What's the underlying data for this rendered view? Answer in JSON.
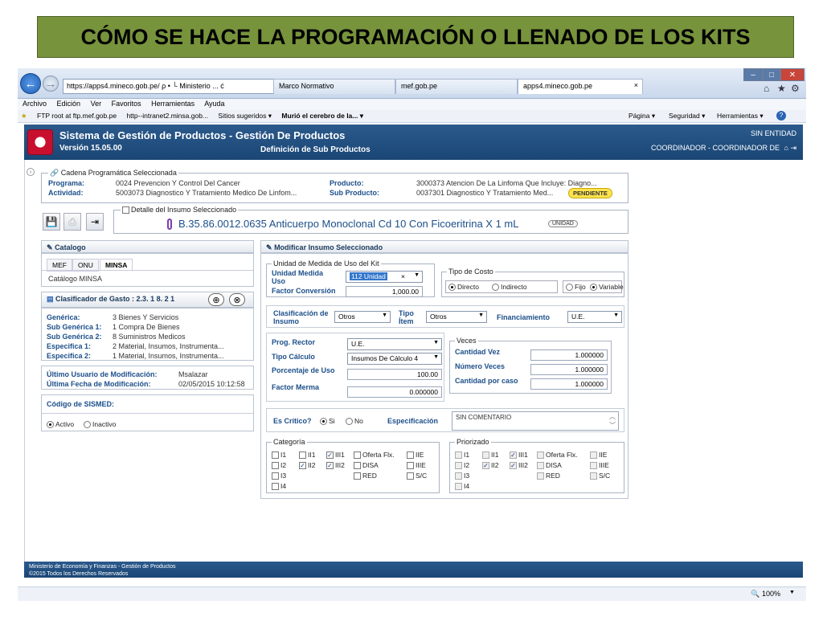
{
  "slide": {
    "title": "CÓMO SE HACE LA PROGRAMACIÓN O LLENADO DE LOS KITS"
  },
  "browser": {
    "address": "https://apps4.mineco.gob.pe/ ρ • └ Ministerio ... ć",
    "address_short": "https://apps4.mineco.gob.pe/",
    "ministerio": "Ministerio ...",
    "tabs": [
      "Marco Normativo",
      "mef.gob.pe",
      "apps4.mineco.gob.pe"
    ],
    "tab_close": "×",
    "menu": [
      "Archivo",
      "Edición",
      "Ver",
      "Favoritos",
      "Herramientas",
      "Ayuda"
    ],
    "favorites": [
      "FTP root at ftp.mef.gob.pe",
      "http--intranet2.minsa.gob...",
      "Sitios sugeridos ▾",
      "Murió el cerebro de la... ▾"
    ],
    "toolbar_right": [
      "Página ▾",
      "Seguridad ▾",
      "Herramientas ▾",
      "?"
    ],
    "zoom": "100%"
  },
  "app": {
    "title": "Sistema de Gestión de Productos - Gestión De Productos",
    "version": "Versión 15.05.00",
    "subtitle": "Definición de Sub Productos",
    "entity": "SIN ENTIDAD",
    "user": "COORDINADOR - COORDINADOR DE",
    "cadena": {
      "legend": "Cadena Programática Seleccionada",
      "programa_label": "Programa:",
      "programa": "0024 Prevencion Y Control Del Cancer",
      "actividad_label": "Actividad:",
      "actividad": "5003073 Diagnostico Y Tratamiento Medico De Linfom...",
      "producto_label": "Producto:",
      "producto": "3000373 Atencion De La Linfoma Que Incluye: Diagno...",
      "subproducto_label": "Sub Producto:",
      "subproducto": "0037301 Diagnostico Y Tratamiento Med...",
      "estado": "PENDIENTE"
    },
    "insumo": {
      "legend": "Detalle del Insumo Seleccionado",
      "name": "B.35.86.0012.0635 Anticuerpo Monoclonal Cd 10 Con Ficoeritrina X 1 mL",
      "unit": "UNIDAD"
    },
    "catalogo": {
      "header": "Catalogo",
      "tabs": [
        "MEF",
        "ONU",
        "MINSA"
      ],
      "content": "Catálogo MINSA"
    },
    "clasificador": {
      "header": "Clasificador de Gasto : 2.3. 1 8. 2 1",
      "rows": [
        {
          "label": "Genérica:",
          "value": "3 Bienes Y Servicios"
        },
        {
          "label": "Sub Genérica 1:",
          "value": "1 Compra De Bienes"
        },
        {
          "label": "Sub Genérica 2:",
          "value": "8 Suministros Medicos"
        },
        {
          "label": "Especifica 1:",
          "value": "2 Material, Insumos, Instrumenta..."
        },
        {
          "label": "Especifica 2:",
          "value": "1 Material, Insumos, Instrumenta..."
        }
      ]
    },
    "modificacion": {
      "usuario_label": "Último Usuario de Modificación:",
      "usuario": "Msalazar",
      "fecha_label": "Última Fecha de Modificación:",
      "fecha": "02/05/2015 10:12:58"
    },
    "sismed": {
      "label": "Código de SISMED:",
      "activo": "Activo",
      "inactivo": "Inactivo"
    },
    "modificar": {
      "header": "Modificar Insumo Seleccionado",
      "unidad_legend": "Unidad de Medida de Uso del Kit",
      "unidad_label": "Unidad Medida Uso",
      "unidad_value": "112 Unidad",
      "unidad_x": "×",
      "factor_label": "Factor Conversión",
      "factor_value": "1,000.00",
      "tipo_costo_legend": "Tipo de Costo",
      "directo": "Directo",
      "indirecto": "Indirecto",
      "fijo": "Fijo",
      "variable": "Variable",
      "clasif_label": "Clasificación de Insumo",
      "clasif_value": "Otros",
      "tipo_item_label": "Tipo Ítem",
      "tipo_item_value": "Otros",
      "financ_label": "Financiamiento",
      "financ_value": "U.E.",
      "prog_rector_label": "Prog. Rector",
      "prog_rector_value": "U.E.",
      "tipo_calc_label": "Tipo Cálculo",
      "tipo_calc_value": "Insumos De Cálculo 4",
      "porc_label": "Porcentaje de Uso",
      "porc_value": "100.00",
      "merma_label": "Factor Merma",
      "merma_value": "0.000000",
      "veces_legend": "Veces",
      "cant_vez_label": "Cantidad Vez",
      "cant_vez_value": "1.000000",
      "num_veces_label": "Número Veces",
      "num_veces_value": "1.000000",
      "cant_caso_label": "Cantidad por caso",
      "cant_caso_value": "1.000000",
      "critico_label": "Es Crítico?",
      "si": "Si",
      "no": "No",
      "espec_label": "Especificación",
      "espec_value": "SIN COMENTARIO",
      "categoria_legend": "Categoría",
      "priorizado_legend": "Priorizado",
      "cat_items": [
        {
          "label": "I1",
          "checked": false
        },
        {
          "label": "II1",
          "checked": false
        },
        {
          "label": "III1",
          "checked": true
        },
        {
          "label": "Oferta Flx.",
          "checked": false
        },
        {
          "label": "IIE",
          "checked": false
        },
        {
          "label": "I2",
          "checked": false
        },
        {
          "label": "II2",
          "checked": true
        },
        {
          "label": "III2",
          "checked": true
        },
        {
          "label": "DISA",
          "checked": false
        },
        {
          "label": "IIIE",
          "checked": false
        },
        {
          "label": "I3",
          "checked": false
        },
        {
          "label": "",
          "checked": null
        },
        {
          "label": "",
          "checked": null
        },
        {
          "label": "RED",
          "checked": false
        },
        {
          "label": "S/C",
          "checked": false
        },
        {
          "label": "I4",
          "checked": false
        }
      ]
    },
    "footer": {
      "line1": "Ministerio de Economía y Finanzas - Gestión de Productos",
      "line2": "©2015 Todos los Derechos Reservados"
    }
  }
}
